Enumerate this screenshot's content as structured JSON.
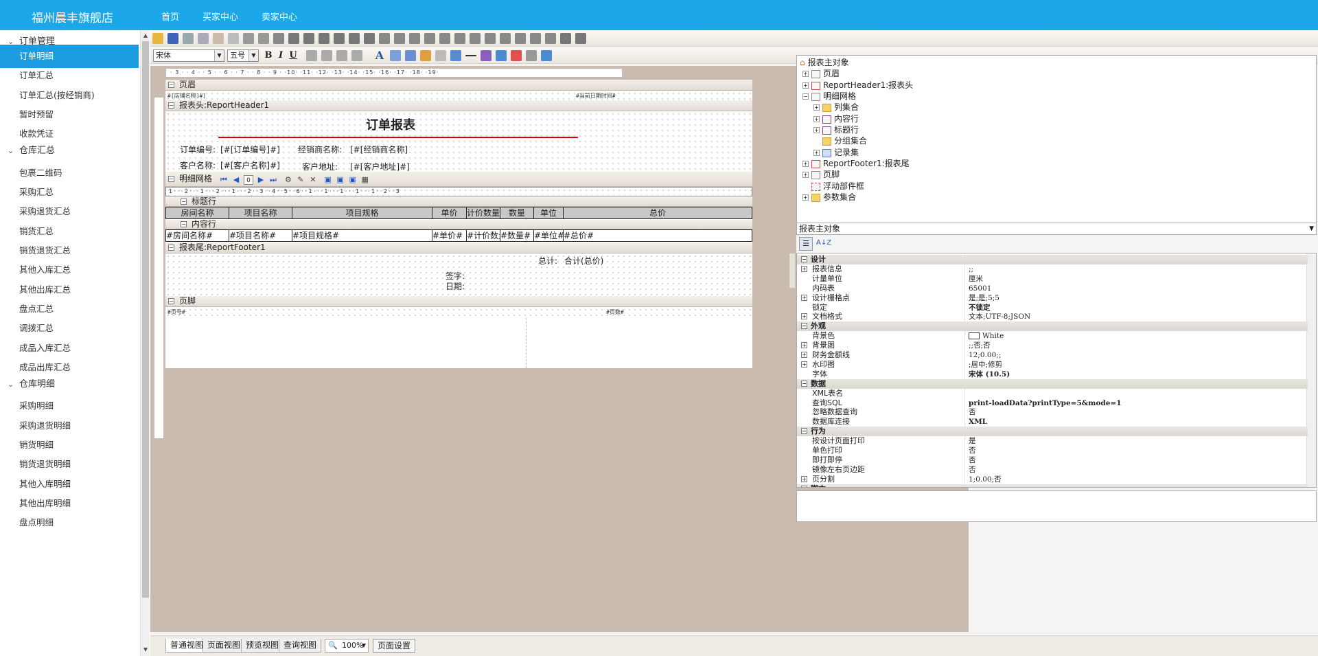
{
  "header": {
    "brand": "福州晨丰旗舰店",
    "nav": [
      "首页",
      "买家中心",
      "卖家中心"
    ]
  },
  "sidebar": {
    "groups": [
      "订单管理",
      "仓库汇总",
      "仓库明细"
    ],
    "items_g1": [
      "订单明细",
      "订单汇总",
      "订单汇总(按经销商)",
      "暂时预留",
      "收款凭证"
    ],
    "items_g2": [
      "包裹二维码",
      "采购汇总",
      "采购退货汇总",
      "销货汇总",
      "销货退货汇总",
      "其他入库汇总",
      "其他出库汇总",
      "盘点汇总",
      "调拨汇总",
      "成品入库汇总",
      "成品出库汇总"
    ],
    "items_g3": [
      "采购明细",
      "采购退货明细",
      "销货明细",
      "销货退货明细",
      "其他入库明细",
      "其他出库明细",
      "盘点明细"
    ]
  },
  "toolbar": {
    "font": "宋体",
    "size": "五号",
    "bold": "B",
    "italic": "I",
    "underline": "U",
    "text_tool": "A"
  },
  "ruler_top": "· 3 · · 4 · · 5 · · 6 · · 7 · · 8 · · 9 · ·10· ·11· ·12· ·13· ·14· ·15· ·16· ·17· ·18· ·19·",
  "ruler_grid": "1 · · · 2 · · · 1 · · · 2 · · · 1 · · · 2 · · 3 · · 4 · · 5 · · 6 · · 1 · · · 1 · · · 1 · · · 1 · · · 1 · · 2 · · 3",
  "report": {
    "page_header": "页眉",
    "page_header_left": "#[店铺名称]#]",
    "page_header_right": "#当前日期时间#",
    "report_header": "报表头:ReportHeader1",
    "title": "订单报表",
    "order_no_label": "订单编号:",
    "order_no_field": "[#[订单编号]#]",
    "dealer_label": "经销商名称:",
    "dealer_field": "[#[经销商名称]",
    "customer_label": "客户名称:",
    "customer_field": "[#[客户名称]#]",
    "address_label": "客户地址:",
    "address_field": "[#[客户地址]#]",
    "grid_band": "明细网格",
    "title_row": "标题行",
    "content_row": "内容行",
    "columns": [
      "房间名称",
      "项目名称",
      "项目规格",
      "单价",
      "计价数量",
      "数量",
      "单位",
      "总价"
    ],
    "cells": [
      "#房间名称#",
      "#项目名称#",
      "#项目规格#",
      "#单价#",
      "#计价数量#",
      "#数量#",
      "#单位#",
      "#总价#"
    ],
    "report_footer": "报表尾:ReportFooter1",
    "total_label": "总计:",
    "total_value": "合计(总价)",
    "sign_label": "签字:",
    "date_label": "日期:",
    "page_footer": "页脚",
    "page_no": "#页号#",
    "page_count": "#页数#"
  },
  "tree": {
    "root": "报表主对象",
    "nodes": [
      "页眉",
      "ReportHeader1:报表头",
      "明细网格",
      "列集合",
      "内容行",
      "标题行",
      "分组集合",
      "记录集",
      "ReportFooter1:报表尾",
      "页脚",
      "浮动部件框",
      "参数集合"
    ]
  },
  "props": {
    "object": "报表主对象",
    "sort_icon": "A↓Z",
    "rows": [
      {
        "cat": true,
        "n": "设计"
      },
      {
        "n": "报表信息",
        "v": ";;",
        "exp": true
      },
      {
        "n": "计量单位",
        "v": "厘米"
      },
      {
        "n": "内码表",
        "v": "65001"
      },
      {
        "n": "设计栅格点",
        "v": "是;是;5;5",
        "exp": true
      },
      {
        "n": "锁定",
        "v": "不锁定"
      },
      {
        "n": "文档格式",
        "v": "文本;UTF-8;JSON",
        "exp": true
      },
      {
        "cat": true,
        "n": "外观"
      },
      {
        "n": "背景色",
        "v": "White"
      },
      {
        "n": "背景图",
        "v": ";;否;否",
        "exp": true
      },
      {
        "n": "财务金额线",
        "v": "12;0.00;;",
        "exp": true
      },
      {
        "n": "水印图",
        "v": ";居中;修剪",
        "exp": true
      },
      {
        "n": "字体",
        "v": "宋体 (10.5)"
      },
      {
        "cat": true,
        "n": "数据"
      },
      {
        "n": "XML表名",
        "v": ""
      },
      {
        "n": "查询SQL",
        "v": "print-loadData?printType=5&mode=1"
      },
      {
        "n": "忽略数据查询",
        "v": "否"
      },
      {
        "n": "数据库连接",
        "v": "XML"
      },
      {
        "cat": true,
        "n": "行为"
      },
      {
        "n": "按设计页面打印",
        "v": "是"
      },
      {
        "n": "单色打印",
        "v": "否"
      },
      {
        "n": "即打即停",
        "v": "否"
      },
      {
        "n": "镜像左右页边距",
        "v": "否"
      },
      {
        "n": "页分割",
        "v": "1;0.00;否",
        "exp": true
      },
      {
        "cat": true,
        "n": "脚本"
      }
    ]
  },
  "bottom": {
    "tabs": [
      "普通视图",
      "页面视图",
      "预览视图",
      "查询视图"
    ],
    "zoom": "100%",
    "page_setup": "页面设置"
  },
  "colors": {
    "brand": "#1ba7e8",
    "active": "#1b9be0",
    "canvas": "#c9bbb0",
    "title_underline": "#dd0000"
  }
}
